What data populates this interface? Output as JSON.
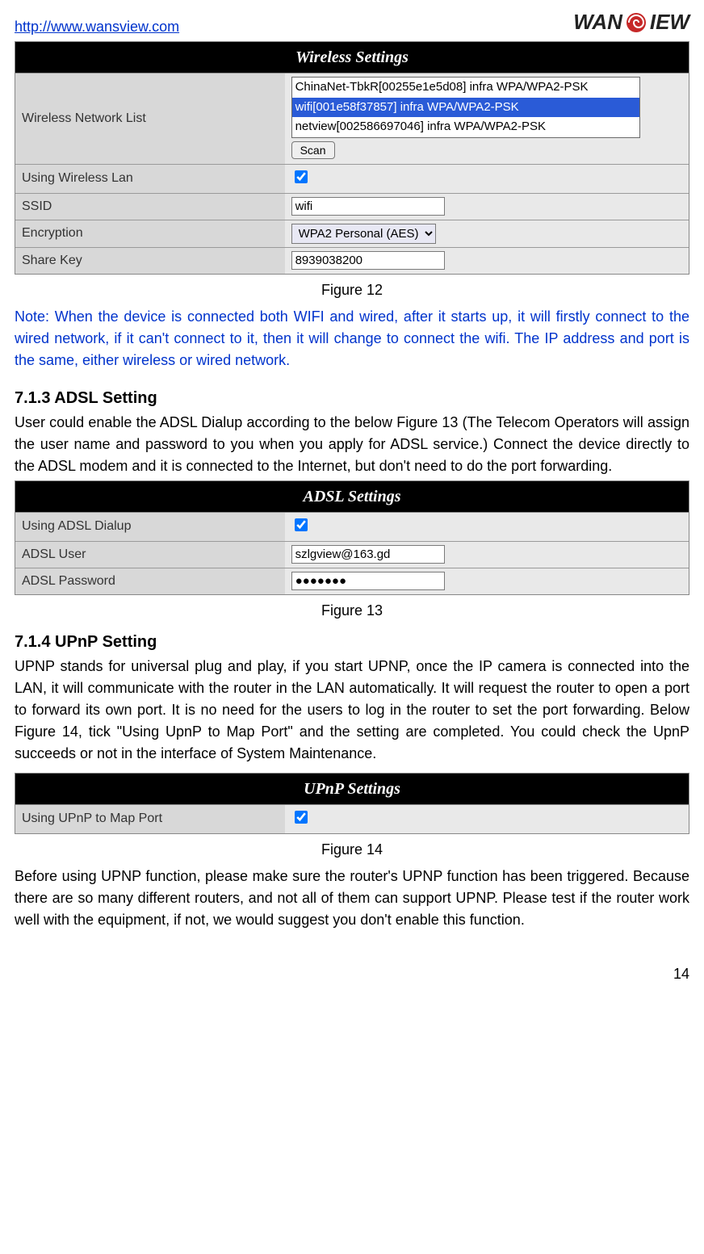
{
  "header": {
    "url": "http://www.wansview.com",
    "logo_text_left": "WAN",
    "logo_text_right": "IEW"
  },
  "wireless": {
    "title": "Wireless  Settings",
    "list_label": "Wireless Network List",
    "options": [
      "ChinaNet-TbkR[00255e1e5d08] infra WPA/WPA2-PSK",
      "wifi[001e58f37857] infra WPA/WPA2-PSK",
      "netview[002586697046] infra WPA/WPA2-PSK"
    ],
    "scan_label": "Scan",
    "using_label": "Using Wireless Lan",
    "ssid_label": "SSID",
    "ssid_value": "wifi",
    "encryption_label": "Encryption",
    "encryption_value": "WPA2 Personal (AES)",
    "key_label": "Share Key",
    "key_value": "8939038200"
  },
  "fig12_caption": "Figure 12",
  "note": "Note: When the device is connected both WIFI and wired, after it starts up, it will firstly connect to the wired network, if it can't connect to it, then it will change to connect the wifi. The IP address and port is the same, either wireless or wired network.",
  "adsl_section": {
    "heading": "7.1.3   ADSL Setting",
    "para": "User could enable the ADSL Dialup according to the below Figure 13 (The Telecom Operators will assign the user name and password to you when you apply for ADSL service.) Connect the device directly to the ADSL modem and it is connected to the Internet, but don't need to do the port forwarding."
  },
  "adsl": {
    "title": "ADSL  Settings",
    "using_label": "Using ADSL Dialup",
    "user_label": "ADSL User",
    "user_value": "szlgview@163.gd",
    "pw_label": "ADSL Password",
    "pw_value": "●●●●●●●"
  },
  "fig13_caption": "Figure 13",
  "upnp_section": {
    "heading": "7.1.4   UPnP Setting",
    "para": "UPNP stands for universal plug and play, if you start UPNP, once the IP camera is connected into the LAN, it will communicate with the router in the LAN automatically. It will request the router to open a port to forward its own port. It is no need for the users to log in the router to set the port forwarding. Below Figure 14, tick \"Using UpnP to Map Port\" and the setting are completed. You could check the UpnP succeeds or not in the interface of System Maintenance."
  },
  "upnp": {
    "title": "UPnP Settings",
    "using_label": "Using UPnP to Map Port"
  },
  "fig14_caption": "Figure 14",
  "closing_para": "Before using UPNP function, please make sure the router's UPNP function has been triggered. Because there are so many different routers, and not all of them can support UPNP. Please test if the router work well with the equipment, if not, we would suggest you don't enable this function.",
  "page_number": "14"
}
